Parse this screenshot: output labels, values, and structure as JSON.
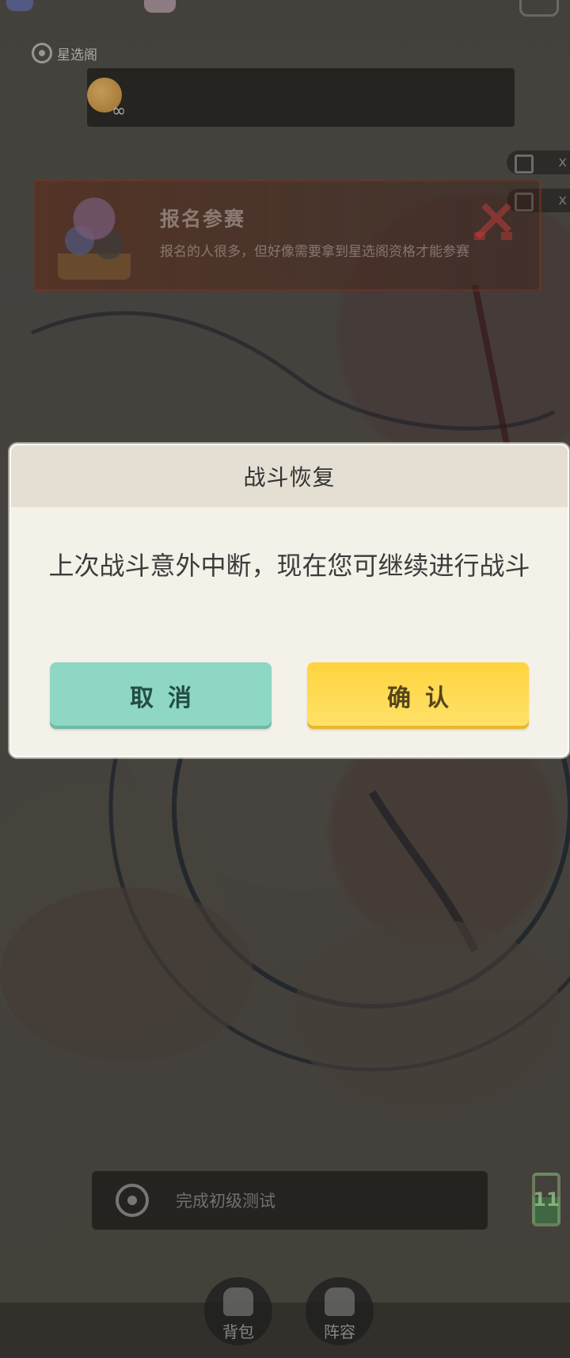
{
  "top": {
    "location_label": "星选阁"
  },
  "side_buttons": [
    {
      "label": "x"
    },
    {
      "label": "x"
    }
  ],
  "quest": {
    "title": "报名参赛",
    "description": "报名的人很多，但好像需要拿到星选阁资格才能参赛"
  },
  "dialog": {
    "title": "战斗恢复",
    "message": "上次战斗意外中断，现在您可继续进行战斗",
    "cancel_label": "取消",
    "confirm_label": "确认"
  },
  "mission": {
    "text": "完成初级测试"
  },
  "battery": {
    "value": "11"
  },
  "tabs": [
    {
      "label": "背包"
    },
    {
      "label": "阵容"
    }
  ],
  "colors": {
    "cancel_button": "#8dd7c4",
    "confirm_button": "#ffd33f",
    "dialog_bg": "#f4f1e8",
    "dialog_header_bg": "#e4dfd2"
  }
}
